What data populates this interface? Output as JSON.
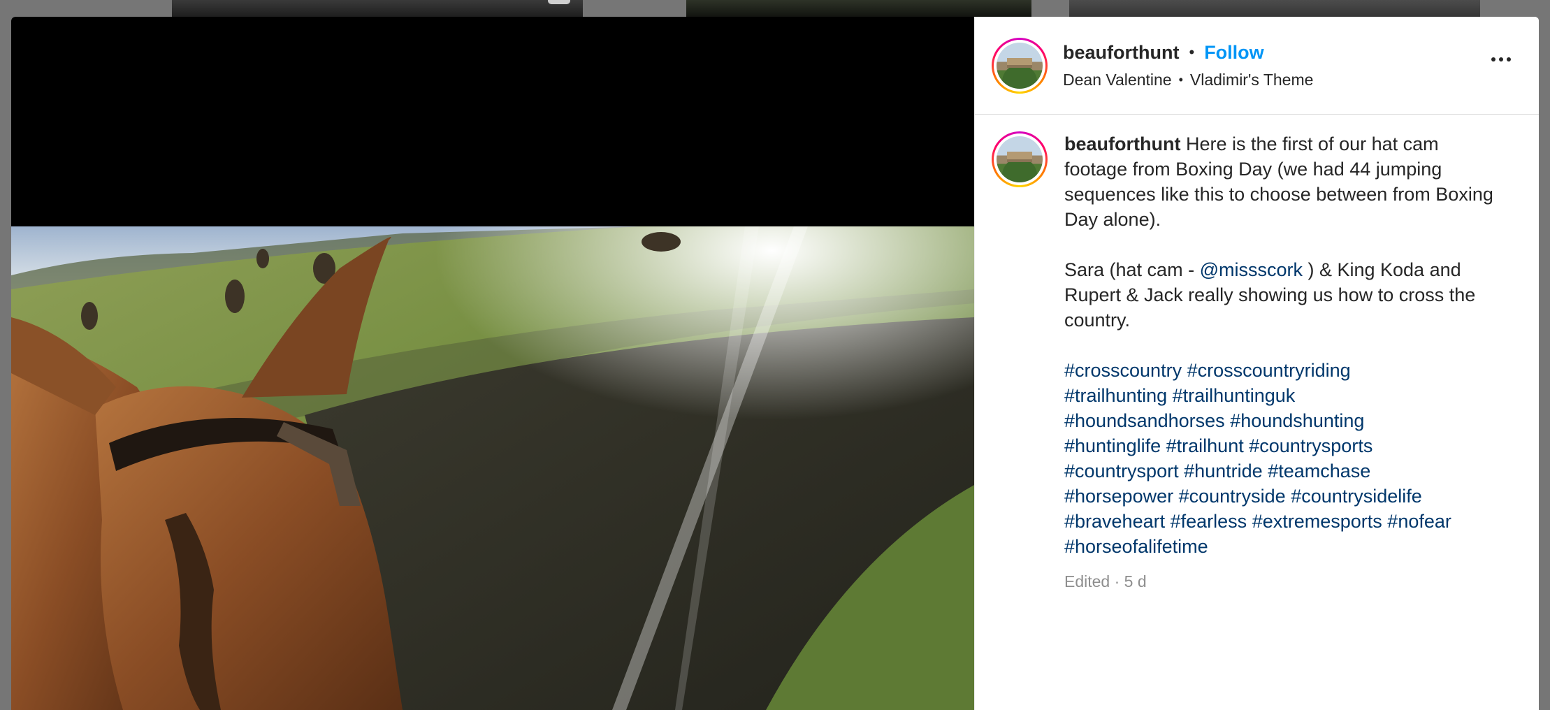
{
  "background": {
    "tiles": [
      "feed-tile-1",
      "feed-tile-2",
      "feed-tile-3"
    ]
  },
  "post": {
    "header": {
      "username": "beauforthunt",
      "follow_label": "Follow",
      "separator": "•",
      "subtitle_name": "Dean Valentine",
      "subtitle_audio": "Vladimir's Theme",
      "more_icon": "more-horizontal-icon"
    },
    "caption": {
      "username": "beauforthunt",
      "line1": "Here is the first of our hat cam footage from Boxing Day (we had 44 jumping sequences like this to choose between from Boxing Day alone).",
      "para2_before": "Sara (hat cam - ",
      "mention": "@missscork",
      "para2_after": " ) & King Koda and Rupert & Jack really showing us how to cross the country.",
      "hashtags": [
        "#crosscountry",
        "#crosscountryriding",
        "#trailhunting",
        "#trailhuntinguk",
        "#houndsandhorses",
        "#houndshunting",
        "#huntinglife",
        "#trailhunt",
        "#countrysports",
        "#countrysport",
        "#huntride",
        "#teamchase",
        "#horsepower",
        "#countryside",
        "#countrysidelife",
        "#braveheart",
        "#fearless",
        "#extremesports",
        "#nofear",
        "#horseofalifetime"
      ],
      "meta": "Edited · 5 d"
    }
  },
  "colors": {
    "link": "#00376b",
    "follow": "#0095f6",
    "text": "#262626",
    "muted": "#8e8e8e"
  }
}
